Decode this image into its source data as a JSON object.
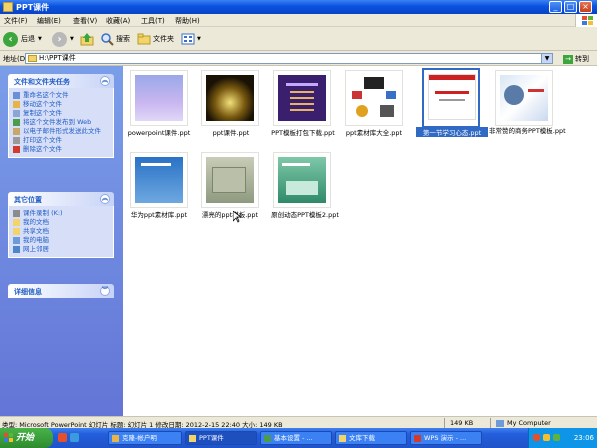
{
  "window": {
    "title": "PPT课件"
  },
  "menu": [
    "文件(F)",
    "编辑(E)",
    "查看(V)",
    "收藏(A)",
    "工具(T)",
    "帮助(H)"
  ],
  "toolbar": {
    "back": "后退",
    "search": "搜索",
    "folders": "文件夹"
  },
  "address": {
    "label": "地址(D)",
    "path": "H:\\PPT课件",
    "go": "转到"
  },
  "file_tasks": {
    "title": "文件和文件夹任务",
    "items": [
      "重命名这个文件",
      "移动这个文件",
      "复制这个文件",
      "将这个文件发布到 Web",
      "以电子邮件形式发送此文件",
      "打印这个文件",
      "删除这个文件"
    ]
  },
  "other_places": {
    "title": "其它位置",
    "items": [
      "课件录制 (K:)",
      "我的文档",
      "共享文档",
      "我的电脑",
      "网上邻居"
    ]
  },
  "details": {
    "title": "详细信息"
  },
  "files": [
    {
      "name": "powerpoint课件.ppt",
      "selected": false
    },
    {
      "name": "ppt课件.ppt",
      "selected": false
    },
    {
      "name": "PPT模板打包下载.ppt",
      "selected": false
    },
    {
      "name": "ppt素材库大全.ppt",
      "selected": false
    },
    {
      "name": "第一节学习心态.ppt",
      "selected": true
    },
    {
      "name": "非常赞的商务PPT模板.ppt",
      "selected": false
    },
    {
      "name": "华为ppt素材库.ppt",
      "selected": false
    },
    {
      "name": "漂亮的ppt模板.ppt",
      "selected": false
    },
    {
      "name": "原创动态PPT模板2.ppt",
      "selected": false
    }
  ],
  "status": {
    "info": "类型: Microsoft PowerPoint 幻灯片 标题: 幻灯片 1 修改日期: 2012-2-15 22:40 大小: 149 KB",
    "size": "149 KB",
    "location": "My Computer"
  },
  "taskbar": {
    "start": "开始",
    "buttons": [
      "克隆-帐户明",
      "PPT课件",
      "基本设置 - ...",
      "文库下载",
      "WPS 演示 - ..."
    ],
    "clock": "23:06"
  },
  "colors": {
    "titlebar": "#0a52e0",
    "leftpane": "#7b9ee9",
    "selection": "#316ac5",
    "link": "#215dc6"
  }
}
